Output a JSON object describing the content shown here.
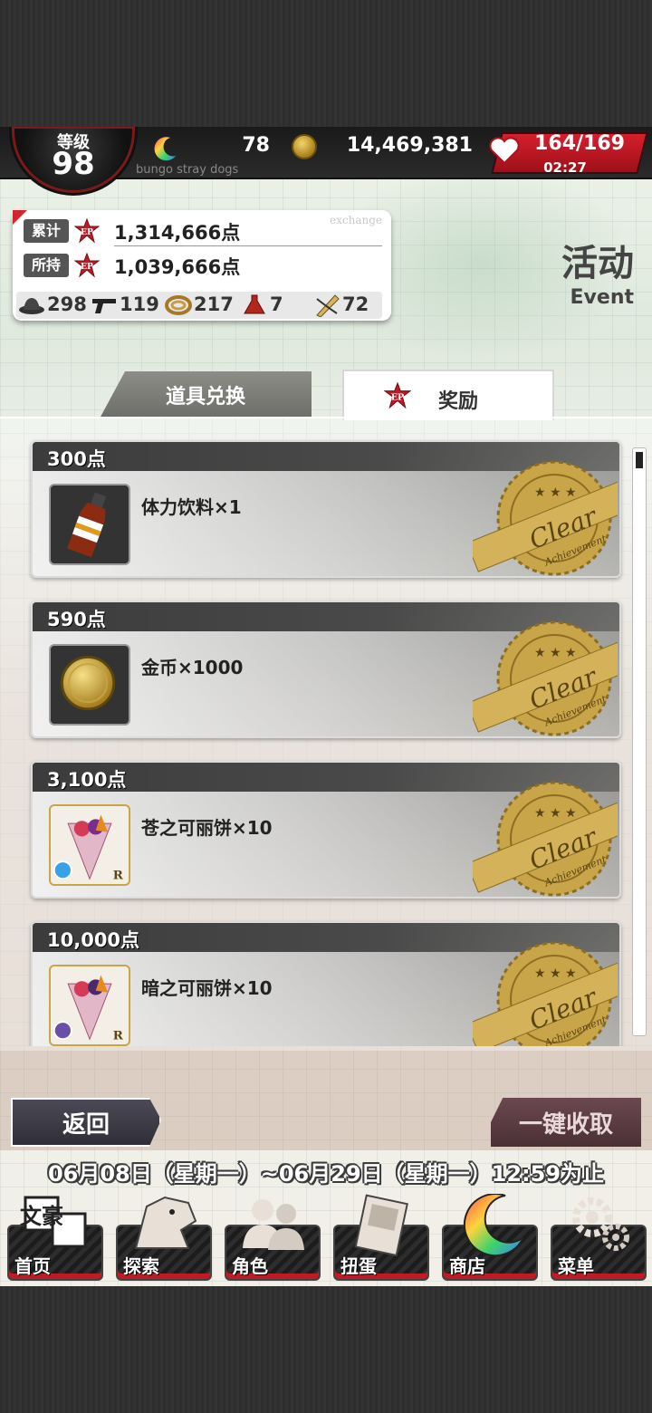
{
  "hud": {
    "level_label": "等级",
    "level_value": "98",
    "stamina_value": "78",
    "subtitle": "bungo stray dogs",
    "coins_value": "14,469,381",
    "hp_value": "164/169",
    "hp_timer": "02:27"
  },
  "points_card": {
    "exchange_tag": "exchange",
    "total_label": "累计",
    "total_value": "1,314,666点",
    "owned_label": "所持",
    "owned_value": "1,039,666点",
    "ep_icon_text": "EP",
    "materials": [
      {
        "icon": "hat-icon",
        "value": "298"
      },
      {
        "icon": "pistol-icon",
        "value": "119"
      },
      {
        "icon": "rope-icon",
        "value": "217"
      },
      {
        "icon": "potion-icon",
        "value": "7"
      },
      {
        "icon": "pen-icon",
        "value": "72"
      }
    ]
  },
  "page": {
    "title": "活动",
    "subtitle": "Event"
  },
  "tabs": {
    "exchange_label": "道具兑换",
    "reward_label": "奖励"
  },
  "rewards": [
    {
      "threshold": "300点",
      "name": "体力饮料×1",
      "icon": "drink-bottle-icon",
      "status": "Clear",
      "stamp_sub": "Achievement"
    },
    {
      "threshold": "590点",
      "name": "金币×1000",
      "icon": "gold-coin-icon",
      "status": "Clear",
      "stamp_sub": "Achievement"
    },
    {
      "threshold": "3,100点",
      "name": "苍之可丽饼×10",
      "icon": "crepe-blue-icon",
      "rarity": "R",
      "status": "Clear",
      "stamp_sub": "Achievement"
    },
    {
      "threshold": "10,000点",
      "name": "暗之可丽饼×10",
      "icon": "crepe-dark-icon",
      "rarity": "R",
      "status": "Clear",
      "stamp_sub": "Achievement"
    }
  ],
  "actions": {
    "back_label": "返回",
    "collect_all_label": "一键收取"
  },
  "period": "06月08日（星期一）~06月29日（星期一）12:59为止",
  "nav": [
    {
      "label": "首页",
      "icon": "home-logo-icon",
      "glyph": "文豪"
    },
    {
      "label": "探索",
      "icon": "explore-beast-icon"
    },
    {
      "label": "角色",
      "icon": "characters-icon"
    },
    {
      "label": "扭蛋",
      "icon": "gacha-book-icon"
    },
    {
      "label": "商店",
      "icon": "shop-moon-icon"
    },
    {
      "label": "菜单",
      "icon": "menu-gears-icon"
    }
  ],
  "colors": {
    "accent_red": "#d61f2d",
    "stamp_gold": "#c9a54a",
    "panel_dark": "#3c3c3c"
  }
}
